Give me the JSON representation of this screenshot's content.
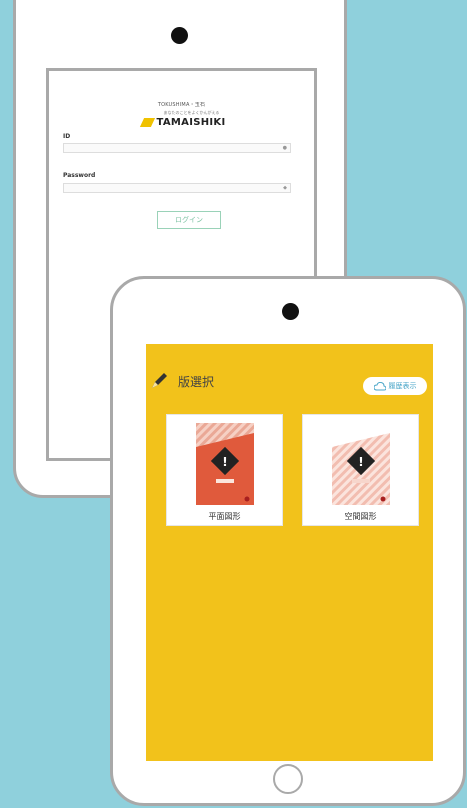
{
  "back_tablet": {
    "brand_top": "TOKUSHIMA・玉石",
    "brand_sub": "あなたのことをよくかんがえる",
    "brand_name": "TAMAISHIKI",
    "id_label": "ID",
    "password_label": "Password",
    "login_button": "ログイン"
  },
  "front_tablet": {
    "title": "版選択",
    "history_button": "履歴表示",
    "books": [
      {
        "caption": "平面図形",
        "color": "#e05a3c",
        "pattern": "#f4b8a8"
      },
      {
        "caption": "空間図形",
        "color": "#f0a090",
        "pattern": "#f9d3c8"
      }
    ]
  },
  "colors": {
    "background": "#8fd0dc",
    "screen_yellow": "#f2c21b",
    "frame_gray": "#a9a9a9"
  }
}
